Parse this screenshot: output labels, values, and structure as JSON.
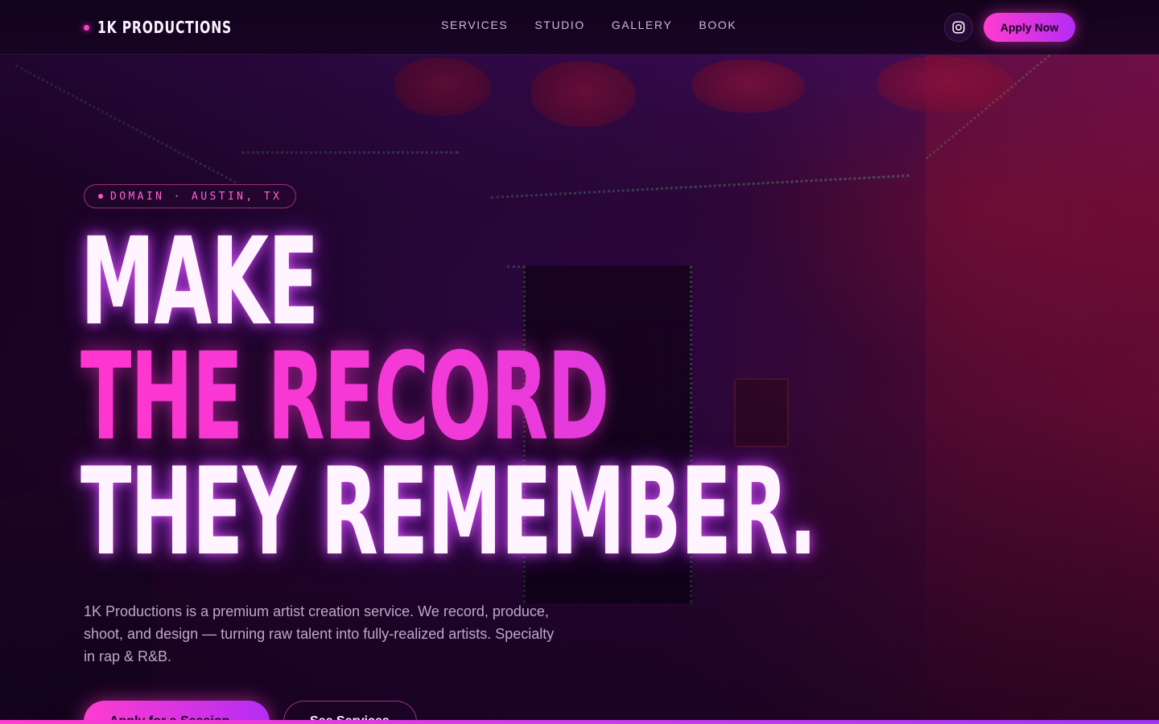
{
  "nav": {
    "brand": "1K PRODUCTIONS",
    "links": [
      "SERVICES",
      "STUDIO",
      "GALLERY",
      "BOOK"
    ],
    "instagram_icon": "instagram-icon",
    "apply_label": "Apply Now"
  },
  "hero": {
    "location_badge": "DOMAIN · AUSTIN, TX",
    "headline": {
      "line1": "MAKE",
      "line2": "THE RECORD",
      "line3": "THEY REMEMBER."
    },
    "description": "1K Productions is a premium artist creation service. We record, produce, shoot, and design — turning raw talent into fully-realized artists. Specialty in rap & R&B.",
    "primary_cta": "Apply for a Session →",
    "secondary_cta": "See Services"
  },
  "colors": {
    "accent_pink": "#ff3ccf",
    "accent_purple": "#b52cf4",
    "background": "#14021c",
    "text_light": "#fff4ff",
    "text_muted": "#bba9c8"
  }
}
